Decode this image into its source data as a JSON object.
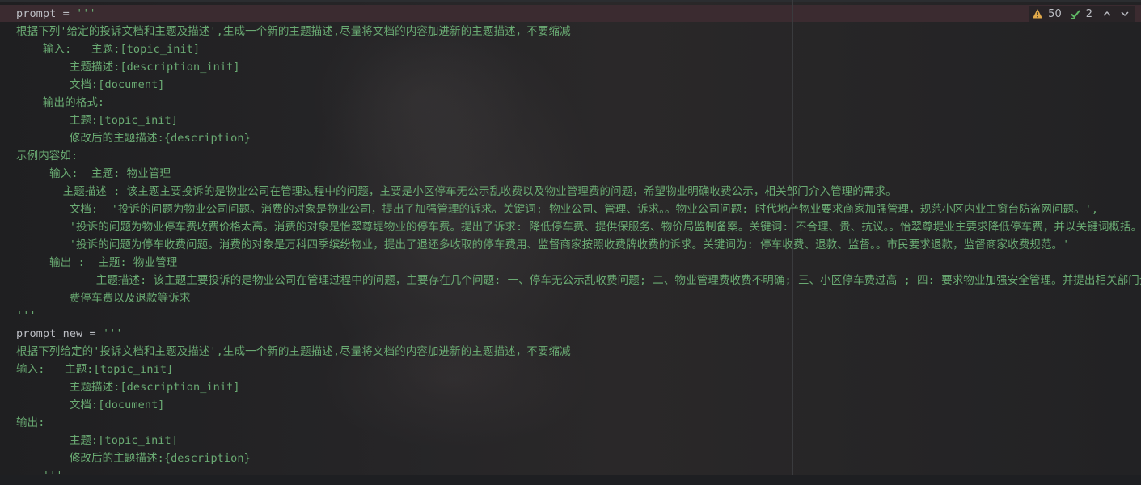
{
  "editor": {
    "lines": [
      {
        "indent": "",
        "parts": [
          {
            "t": "prompt = ",
            "c": "kw"
          },
          {
            "t": "'''",
            "c": "str"
          }
        ]
      },
      {
        "indent": "",
        "parts": [
          {
            "t": "根据下列'给定的投诉文档和主题及描述',生成一个新的主题描述,尽量将文档的内容加进新的主题描述，不要缩减",
            "c": "str"
          }
        ]
      },
      {
        "indent": "    ",
        "parts": [
          {
            "t": "输入:   主题:[topic_init]",
            "c": "str"
          }
        ]
      },
      {
        "indent": "        ",
        "parts": [
          {
            "t": "主题描述:[description_init]",
            "c": "str"
          }
        ]
      },
      {
        "indent": "        ",
        "parts": [
          {
            "t": "文档:[document]",
            "c": "str"
          }
        ]
      },
      {
        "indent": "    ",
        "parts": [
          {
            "t": "输出的格式:",
            "c": "str"
          }
        ]
      },
      {
        "indent": "        ",
        "parts": [
          {
            "t": "主题:[topic_init]",
            "c": "str"
          }
        ]
      },
      {
        "indent": "        ",
        "parts": [
          {
            "t": "修改后的主题描述:{description}",
            "c": "str"
          }
        ]
      },
      {
        "indent": "",
        "parts": [
          {
            "t": "示例内容如:",
            "c": "str"
          }
        ]
      },
      {
        "indent": "     ",
        "parts": [
          {
            "t": "输入:  主题: 物业管理",
            "c": "str"
          }
        ]
      },
      {
        "indent": "       ",
        "parts": [
          {
            "t": "主题描述 : 该主题主要投诉的是物业公司在管理过程中的问题，主要是小区停车无公示乱收费以及物业管理费的问题，希望物业明确收费公示，相关部门介入管理的需求。",
            "c": "str"
          }
        ]
      },
      {
        "indent": "        ",
        "parts": [
          {
            "t": "文档:  '投诉的问题为物业公司问题。消费的对象是物业公司，提出了加强管理的诉求。关键词: 物业公司、管理、诉求。。物业公司问题: 时代地产物业要求商家加强管理，规范小区内业主窗台防盗网问题。',",
            "c": "str"
          }
        ]
      },
      {
        "indent": "        ",
        "parts": [
          {
            "t": "'投诉的问题为物业停车费收费价格太高。消费的对象是怡翠尊堤物业的停车费。提出了诉求: 降低停车费、提供保服务、物价局监制备案。关键词: 不合理、贵、抗议。。怡翠尊堤业主要求降低停车费，并以关键词概括。',",
            "c": "str"
          }
        ]
      },
      {
        "indent": "        ",
        "parts": [
          {
            "t": "'投诉的问题为停车收费问题。消费的对象是万科四季缤纷物业，提出了退还多收取的停车费用、监督商家按照收费牌收费的诉求。关键词为: 停车收费、退款、监督。。市民要求退款，监督商家收费规范。'",
            "c": "str"
          }
        ]
      },
      {
        "indent": "     ",
        "parts": [
          {
            "t": "输出 :  主题: 物业管理",
            "c": "str"
          }
        ]
      },
      {
        "indent": "            ",
        "parts": [
          {
            "t": "主题描述: 该主题主要投诉的是物业公司在管理过程中的问题，主要存在几个问题: 一、停车无公示乱收费问题; 二、物业管理费收费不明确; 三、小区停车费过高 ; 四: 要求物业加强安全管理。并提出相关部门介入管理、规",
            "c": "str"
          }
        ]
      },
      {
        "indent": "        ",
        "parts": [
          {
            "t": "费停车费以及退款等诉求",
            "c": "str"
          }
        ]
      },
      {
        "indent": "",
        "parts": [
          {
            "t": "'''",
            "c": "str"
          }
        ]
      },
      {
        "indent": "",
        "parts": [
          {
            "t": "prompt_new = ",
            "c": "kw"
          },
          {
            "t": "'''",
            "c": "str"
          }
        ]
      },
      {
        "indent": "",
        "parts": [
          {
            "t": "根据下列给定的'投诉文档和主题及描述',生成一个新的主题描述,尽量将文档的内容加进新的主题描述，不要缩减",
            "c": "str"
          }
        ]
      },
      {
        "indent": "",
        "parts": [
          {
            "t": "输入:   主题:[topic_init]",
            "c": "str"
          }
        ]
      },
      {
        "indent": "        ",
        "parts": [
          {
            "t": "主题描述:[description_init]",
            "c": "str"
          }
        ]
      },
      {
        "indent": "        ",
        "parts": [
          {
            "t": "文档:[document]",
            "c": "str"
          }
        ]
      },
      {
        "indent": "",
        "parts": [
          {
            "t": "输出:",
            "c": "str"
          }
        ]
      },
      {
        "indent": "        ",
        "parts": [
          {
            "t": "主题:[topic_init]",
            "c": "str"
          }
        ]
      },
      {
        "indent": "        ",
        "parts": [
          {
            "t": "修改后的主题描述:{description}",
            "c": "str"
          }
        ]
      },
      {
        "indent": "    ",
        "parts": [
          {
            "t": "'''",
            "c": "str"
          }
        ]
      }
    ]
  },
  "inspections": {
    "warnings": "50",
    "ok": "2"
  },
  "colors": {
    "keyword": "#bcbec4",
    "string": "#6aab73",
    "current_line": "#3b2b30",
    "warning": "#e0a84a",
    "ok": "#5fb865"
  }
}
